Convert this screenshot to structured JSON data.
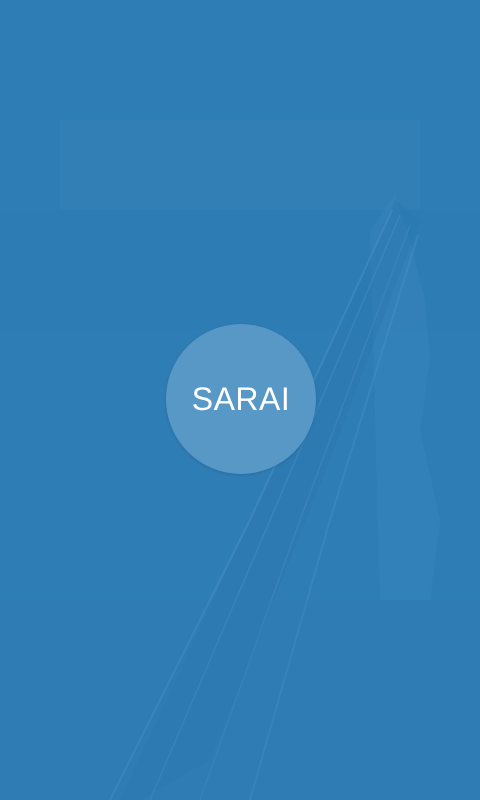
{
  "app": {
    "logo_text": "SARAI"
  },
  "theme": {
    "background": "#2f7db5",
    "logo_circle": "#5898c6",
    "logo_text_color": "#ffffff"
  },
  "background_image": {
    "icon": "highway-aerial-photo"
  }
}
